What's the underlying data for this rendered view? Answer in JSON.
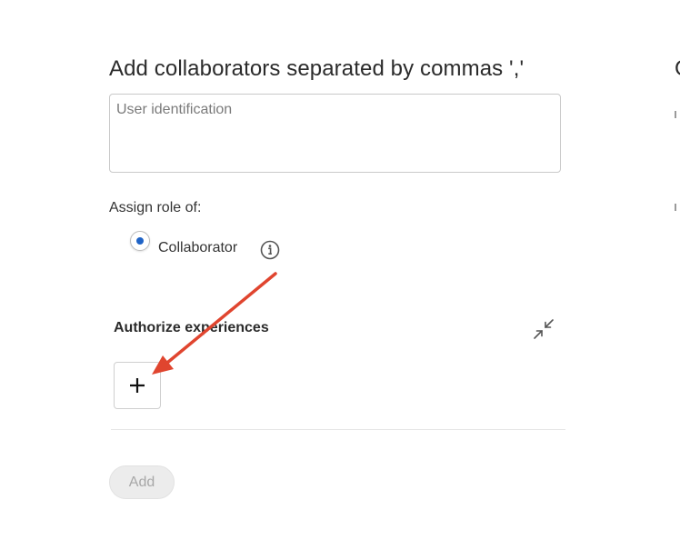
{
  "collaborators": {
    "title": "Add collaborators separated by commas ','",
    "input_placeholder": "User identification",
    "input_value": ""
  },
  "role": {
    "label": "Assign role of:",
    "options": [
      {
        "label": "Collaborator",
        "selected": true
      }
    ],
    "info_icon": "info-icon"
  },
  "experiences": {
    "title": "Authorize experiences",
    "collapse_icon": "collapse-icon",
    "add_icon": "plus-icon"
  },
  "actions": {
    "add_label": "Add",
    "add_disabled": true
  },
  "annotation": {
    "arrow_color": "#e0452f"
  },
  "edge": {
    "clipped_char": "C"
  }
}
